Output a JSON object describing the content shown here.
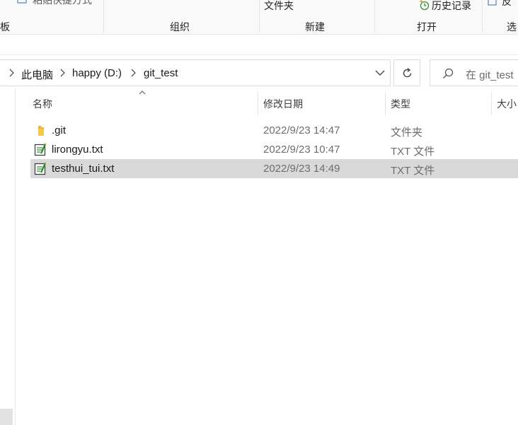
{
  "ribbon": {
    "groups": [
      {
        "label": "占板"
      },
      {
        "label": "组织"
      },
      {
        "label": "新建"
      },
      {
        "label": "打开"
      },
      {
        "label": "选"
      }
    ],
    "new_folder_label": "文件夹",
    "history_label": "历史记录",
    "clipped_top_left": "粘贴快捷方式",
    "clipped_top_right": "反"
  },
  "address": {
    "crumbs": [
      "此电脑",
      "happy (D:)",
      "git_test"
    ]
  },
  "search": {
    "placeholder": "在 git_test"
  },
  "columns": {
    "name": "名称",
    "date": "修改日期",
    "type": "类型",
    "size": "大小"
  },
  "files": [
    {
      "name": ".git",
      "date": "2022/9/23 14:47",
      "type": "文件夹",
      "icon": "folder-icon",
      "selected": false
    },
    {
      "name": "lirongyu.txt",
      "date": "2022/9/23 10:47",
      "type": "TXT 文件",
      "icon": "text-file-icon",
      "selected": false
    },
    {
      "name": "testhui_tui.txt",
      "date": "2022/9/23 14:49",
      "type": "TXT 文件",
      "icon": "text-file-icon",
      "selected": true
    }
  ],
  "colors": {
    "selected_row": "#d9d9d9",
    "ribbon_bg": "#f9f9f9",
    "folder": "#f5c84c",
    "text_file_accent": "#2e8b2e"
  }
}
